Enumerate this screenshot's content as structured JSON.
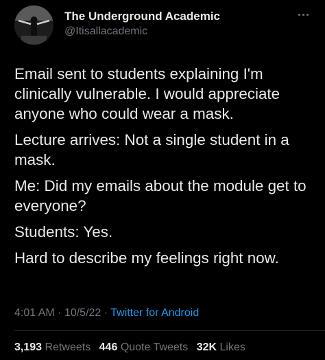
{
  "author": {
    "display_name": "The Underground Academic",
    "handle": "@Itisallacademic",
    "avatar_icon": "profile-photo"
  },
  "menu": {
    "icon": "more-options-icon"
  },
  "tweet": {
    "paragraphs": [
      "Email sent to students explaining I'm clinically vulnerable. I would appreciate anyone who could wear a mask.",
      "Lecture arrives: Not a single student in a mask.",
      "Me: Did my emails about the module get to everyone?",
      "Students: Yes.",
      "Hard to describe my feelings right now."
    ],
    "time": "4:01 AM",
    "date": "10/5/22",
    "separator": "·",
    "source": "Twitter for Android"
  },
  "stats": {
    "retweets_count": "3,193",
    "retweets_label": "Retweets",
    "quotes_count": "446",
    "quotes_label": "Quote Tweets",
    "likes_count": "32K",
    "likes_label": "Likes"
  },
  "colors": {
    "background": "#000000",
    "text": "#e7e9ea",
    "secondary": "#71767b",
    "link": "#1d9bf0",
    "divider": "#2f3336"
  }
}
